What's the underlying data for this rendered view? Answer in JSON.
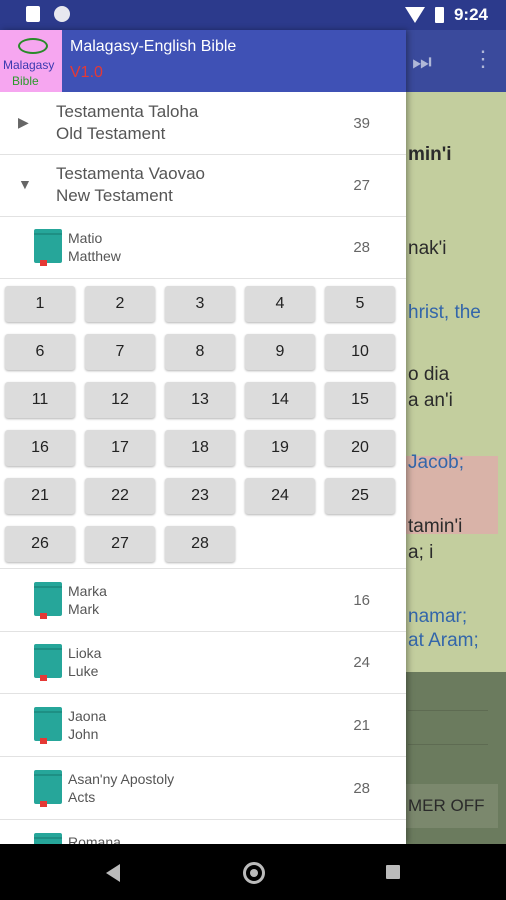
{
  "status_bar": {
    "time": "9:24"
  },
  "header": {
    "app_title": "Malagasy-English Bible",
    "version": "V1.0",
    "logo_text_1": "Malagasy",
    "logo_text_2": "Bible"
  },
  "testaments": [
    {
      "name_mg": "Testamenta Taloha",
      "name_en": "Old Testament",
      "count": "39",
      "expanded": false
    },
    {
      "name_mg": "Testamenta Vaovao",
      "name_en": "New Testament",
      "count": "27",
      "expanded": true
    }
  ],
  "current_book": {
    "name_mg": "Matio",
    "name_en": "Matthew",
    "count": "28"
  },
  "chapters": [
    "1",
    "2",
    "3",
    "4",
    "5",
    "6",
    "7",
    "8",
    "9",
    "10",
    "11",
    "12",
    "13",
    "14",
    "15",
    "16",
    "17",
    "18",
    "19",
    "20",
    "21",
    "22",
    "23",
    "24",
    "25",
    "26",
    "27",
    "28"
  ],
  "books": [
    {
      "name_mg": "Marka",
      "name_en": "Mark",
      "count": "16"
    },
    {
      "name_mg": "Lioka",
      "name_en": "Luke",
      "count": "24"
    },
    {
      "name_mg": "Jaona",
      "name_en": "John",
      "count": "21"
    },
    {
      "name_mg": "Asan'ny Apostoly",
      "name_en": "Acts",
      "count": "28"
    },
    {
      "name_mg": "Romana",
      "name_en": "",
      "count": ""
    }
  ],
  "background_text": [
    "min'i",
    "nak'i",
    "hrist, the",
    "o dia",
    "a an'i",
    "Jacob;",
    "tamin'i",
    "a; i",
    "namar;",
    "at Aram;"
  ],
  "background_button": "MER OFF",
  "colors": {
    "primary": "#3f51b5",
    "book_icon": "#26a69a",
    "version": "#e53935"
  }
}
